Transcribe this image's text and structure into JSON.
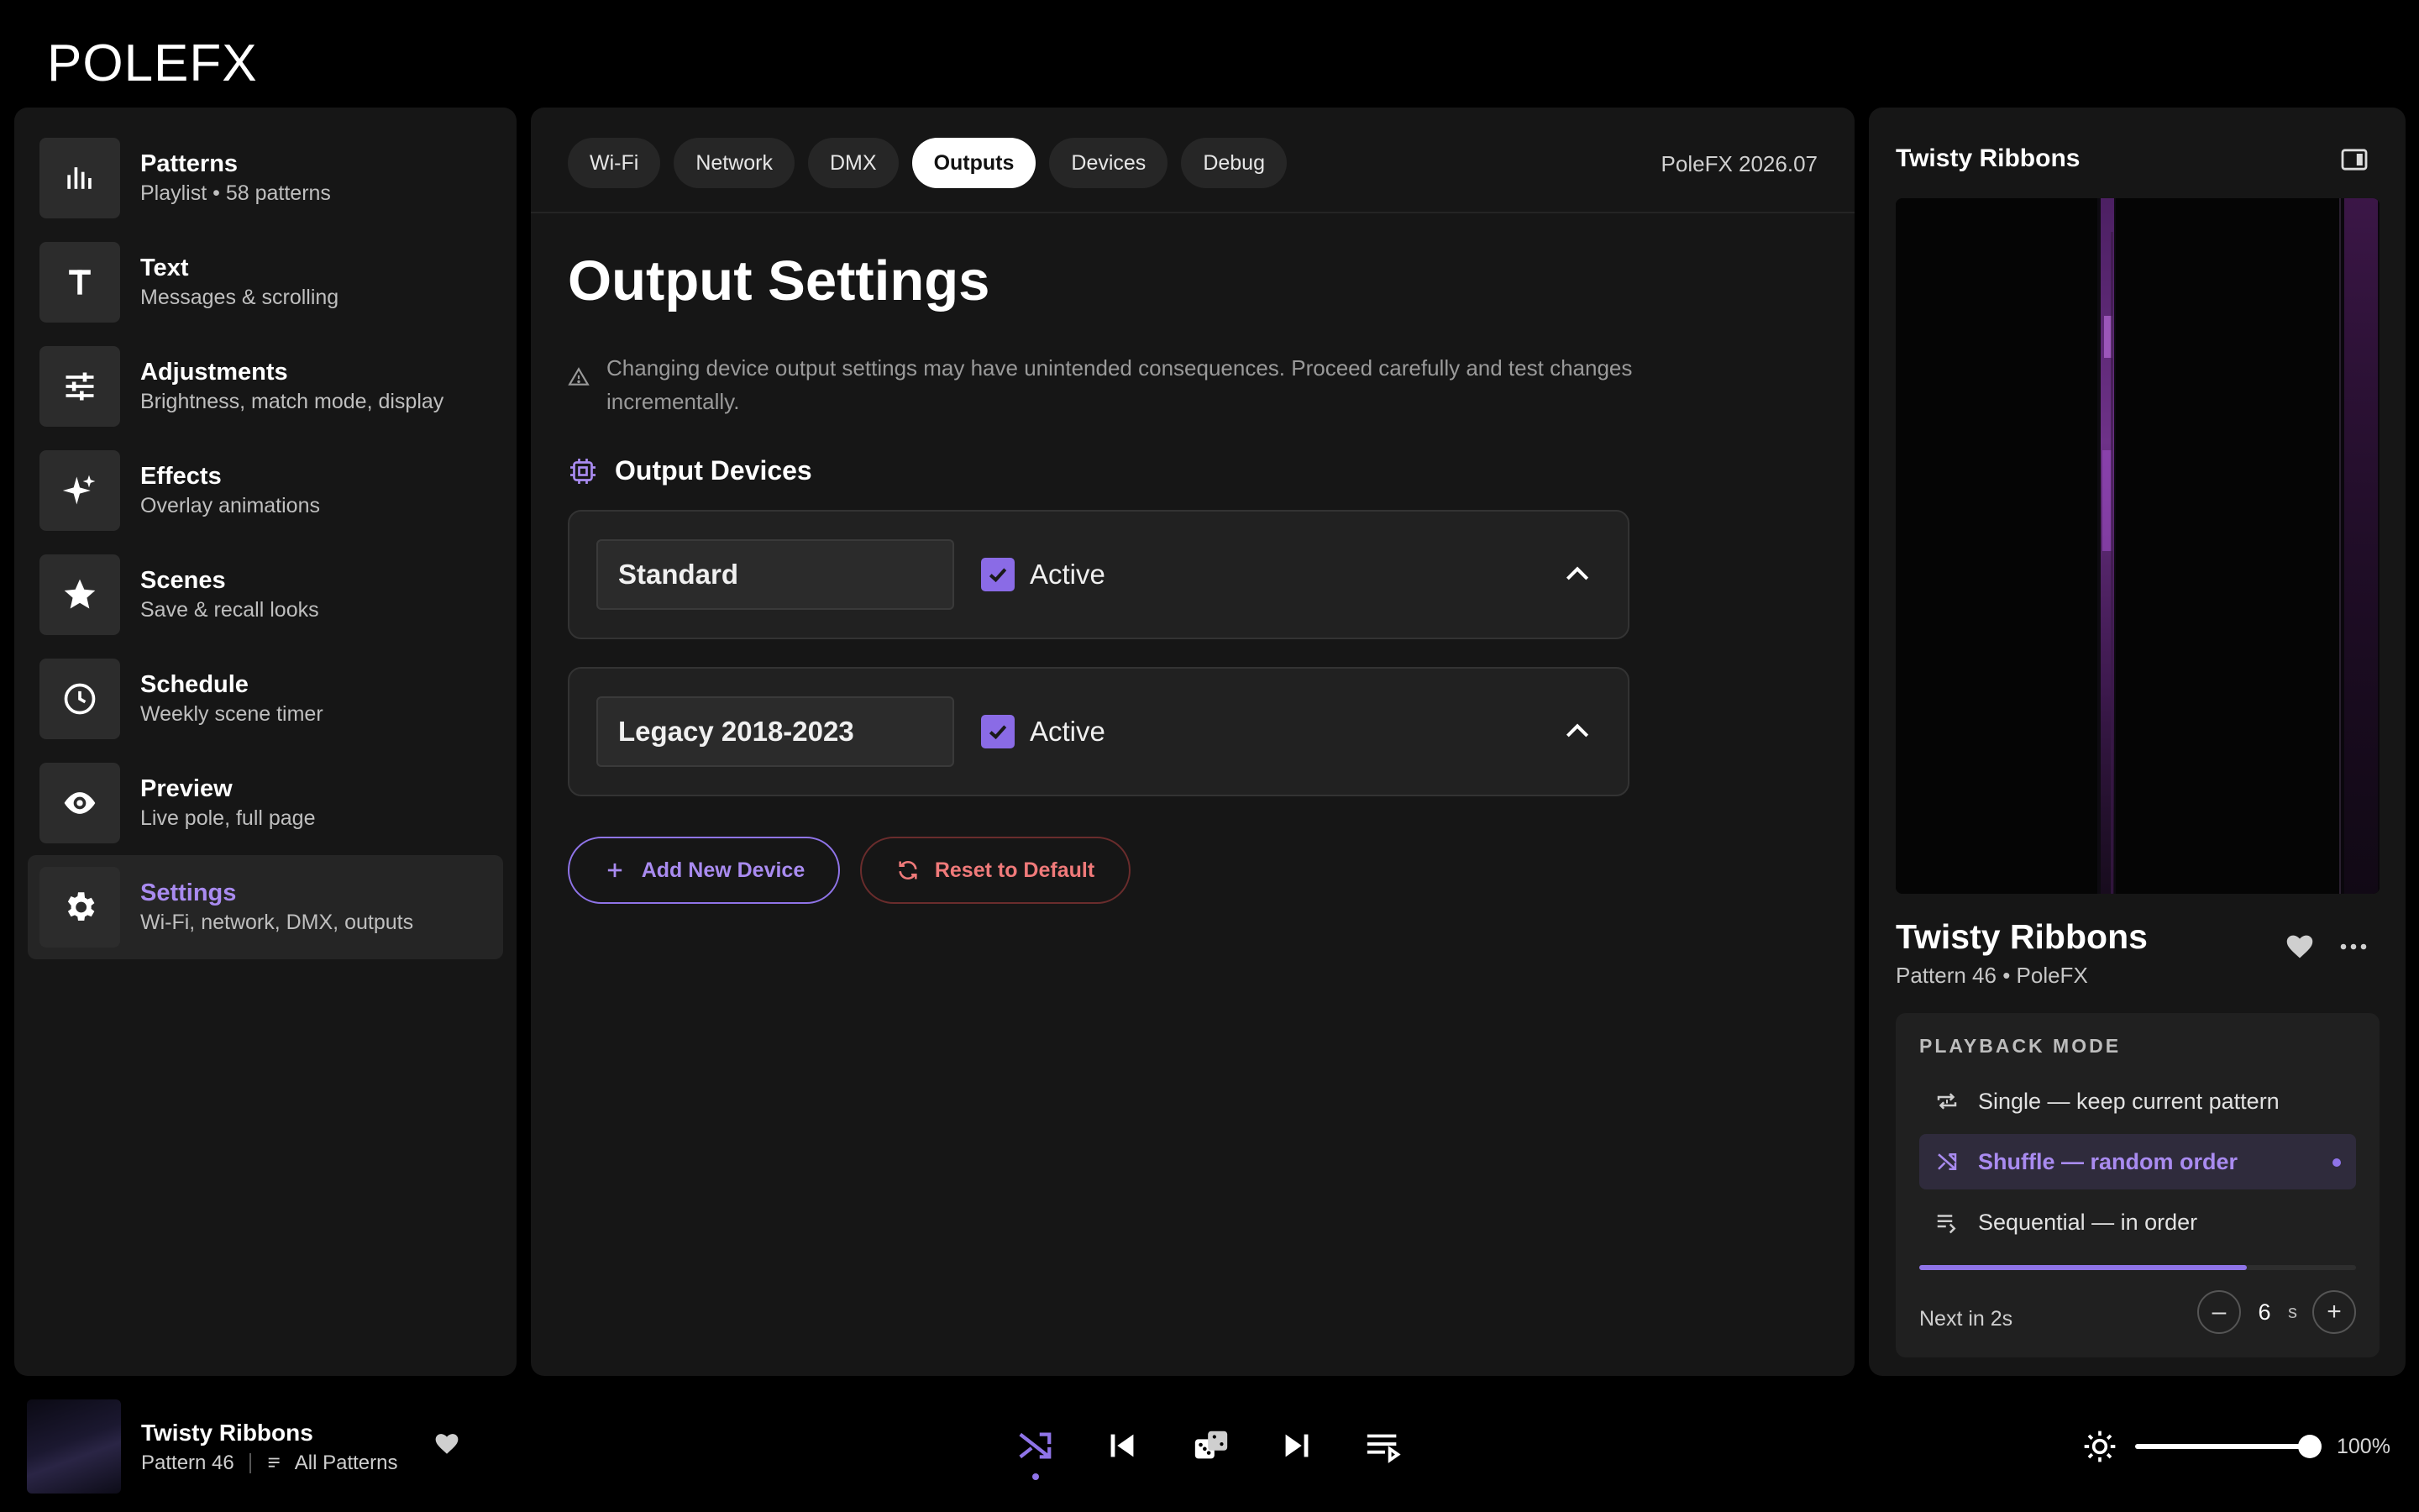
{
  "app": {
    "logo_text": "POLEFX"
  },
  "sidebar": {
    "items": [
      {
        "title": "Patterns",
        "subtitle": "Playlist • 58 patterns",
        "icon": "bar-chart-icon"
      },
      {
        "title": "Text",
        "subtitle": "Messages & scrolling",
        "icon": "text-icon"
      },
      {
        "title": "Adjustments",
        "subtitle": "Brightness, match mode, display",
        "icon": "sliders-icon"
      },
      {
        "title": "Effects",
        "subtitle": "Overlay animations",
        "icon": "sparkles-icon"
      },
      {
        "title": "Scenes",
        "subtitle": "Save & recall looks",
        "icon": "star-icon"
      },
      {
        "title": "Schedule",
        "subtitle": "Weekly scene timer",
        "icon": "clock-icon"
      },
      {
        "title": "Preview",
        "subtitle": "Live pole, full page",
        "icon": "eye-icon"
      },
      {
        "title": "Settings",
        "subtitle": "Wi-Fi, network, DMX, outputs",
        "icon": "gear-icon",
        "active": true
      }
    ]
  },
  "main": {
    "tabs": [
      {
        "label": "Wi-Fi"
      },
      {
        "label": "Network"
      },
      {
        "label": "DMX"
      },
      {
        "label": "Outputs",
        "active": true
      },
      {
        "label": "Devices"
      },
      {
        "label": "Debug"
      }
    ],
    "version": "PoleFX 2026.07",
    "page_title": "Output Settings",
    "warning": "Changing device output settings may have unintended consequences. Proceed carefully and test changes incrementally.",
    "section_title": "Output Devices",
    "devices": [
      {
        "name": "Standard",
        "active_label": "Active",
        "active": true
      },
      {
        "name": "Legacy 2018-2023",
        "active_label": "Active",
        "active": true
      }
    ],
    "add_button": "Add New Device",
    "reset_button": "Reset to Default"
  },
  "now_playing": {
    "header_title": "Twisty Ribbons",
    "title": "Twisty Ribbons",
    "subtitle": "Pattern 46 • PoleFX",
    "playback": {
      "heading": "PLAYBACK MODE",
      "options": [
        {
          "label": "Single — keep current pattern",
          "icon": "repeat-one-icon"
        },
        {
          "label": "Shuffle — random order",
          "icon": "shuffle-icon",
          "active": true
        },
        {
          "label": "Sequential — in order",
          "icon": "list-order-icon"
        }
      ],
      "progress": 0.75,
      "next_text": "Next in 2s",
      "interval_value": "6",
      "interval_unit": "s"
    }
  },
  "player": {
    "title": "Twisty Ribbons",
    "pattern": "Pattern 46",
    "playlist": "All Patterns",
    "brightness": 1.0,
    "brightness_label": "100%"
  },
  "colors": {
    "accent": "#8f74e8",
    "accent_text": "#a98bf0",
    "danger": "#f07a7a",
    "panel": "#161616"
  }
}
